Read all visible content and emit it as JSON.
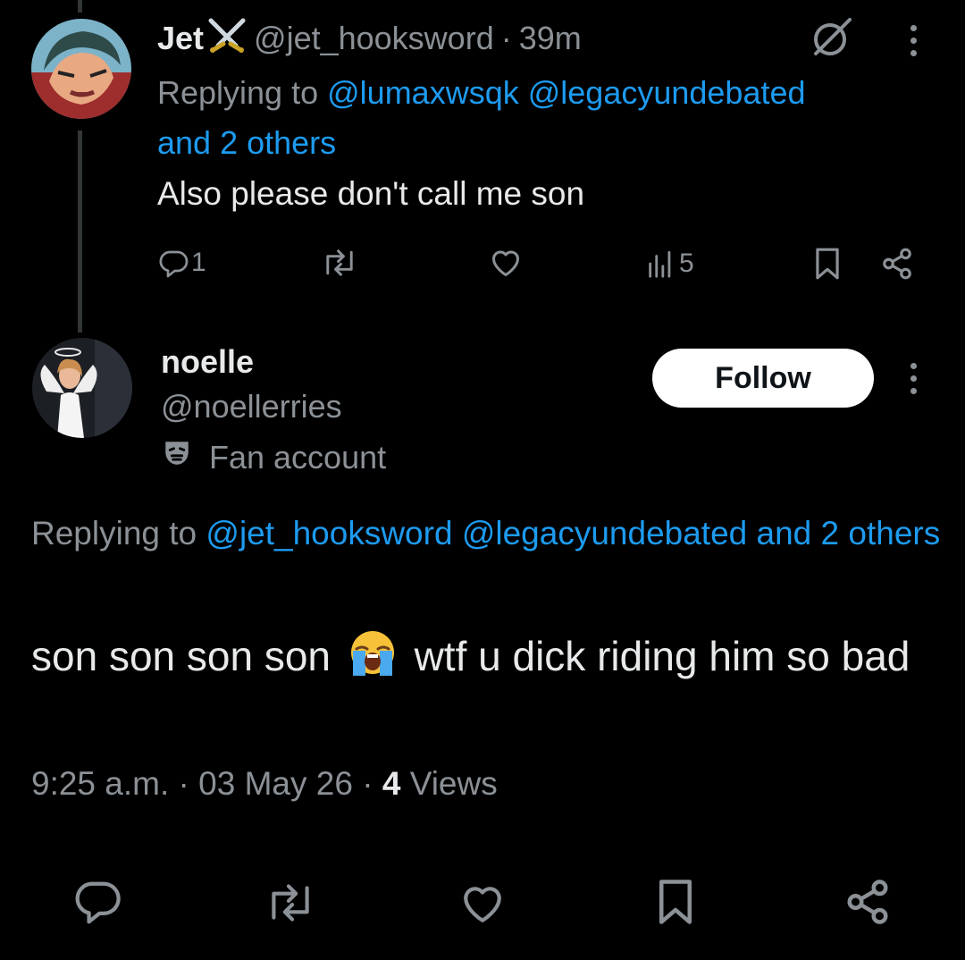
{
  "reply_tweet": {
    "display_name": "Jet",
    "handle": "@jet_hooksword",
    "separator": "·",
    "time_ago": "39m",
    "replying_prefix": "Replying to",
    "replying_mentions": [
      "@lumaxwsqk",
      "@legacyundebated"
    ],
    "replying_others": "and 2 others",
    "text": "Also please don't call me son",
    "replies_count": "1",
    "views_count": "5"
  },
  "main_tweet": {
    "display_name": "noelle",
    "handle": "@noellerries",
    "account_label": "Fan account",
    "follow_label": "Follow",
    "replying_prefix": "Replying to",
    "replying_mentions": [
      "@jet_hooksword",
      "@legacyundebated"
    ],
    "replying_others": "and 2 others",
    "text_before_emoji": "son son son son",
    "emoji": "😭",
    "text_after_emoji": "wtf u dick riding him so bad",
    "time": "9:25 a.m.",
    "date": "03 May 26",
    "views_count": "4",
    "views_label": "Views"
  },
  "icons": {
    "reply": "reply-icon",
    "retweet": "retweet-icon",
    "like": "heart-icon",
    "views": "views-bar-chart-icon",
    "bookmark": "bookmark-icon",
    "share": "share-icon",
    "more": "more-options-icon",
    "grok": "grok-icon",
    "fan_account": "theater-mask-icon"
  },
  "colors": {
    "link": "#1d9bf0",
    "muted": "#8b9196",
    "text": "#e7e9ea",
    "background": "#000000"
  }
}
